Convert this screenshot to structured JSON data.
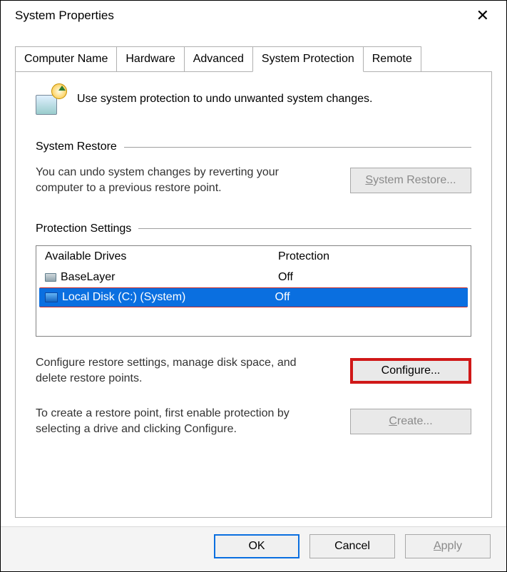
{
  "window_title": "System Properties",
  "close_glyph": "✕",
  "tabs": [
    "Computer Name",
    "Hardware",
    "Advanced",
    "System Protection",
    "Remote"
  ],
  "active_tab_index": 3,
  "intro_text": "Use system protection to undo unwanted system changes.",
  "groups": {
    "restore": {
      "legend": "System Restore",
      "text": "You can undo system changes by reverting your computer to a previous restore point.",
      "button": "System Restore...",
      "mnemonic": "S"
    },
    "settings": {
      "legend": "Protection Settings",
      "col_drive": "Available Drives",
      "col_protection": "Protection",
      "drives": [
        {
          "name": "BaseLayer",
          "protection": "Off",
          "selected": false
        },
        {
          "name": "Local Disk (C:) (System)",
          "protection": "Off",
          "selected": true
        }
      ],
      "configure_hint": "Configure restore settings, manage disk space, and delete restore points.",
      "configure_button": "Configure...",
      "create_hint": "To create a restore point, first enable protection by selecting a drive and clicking Configure.",
      "create_button": "Create...",
      "create_mnemonic": "C"
    }
  },
  "footer": {
    "ok": "OK",
    "cancel": "Cancel",
    "apply": "Apply",
    "apply_mnemonic": "A"
  }
}
